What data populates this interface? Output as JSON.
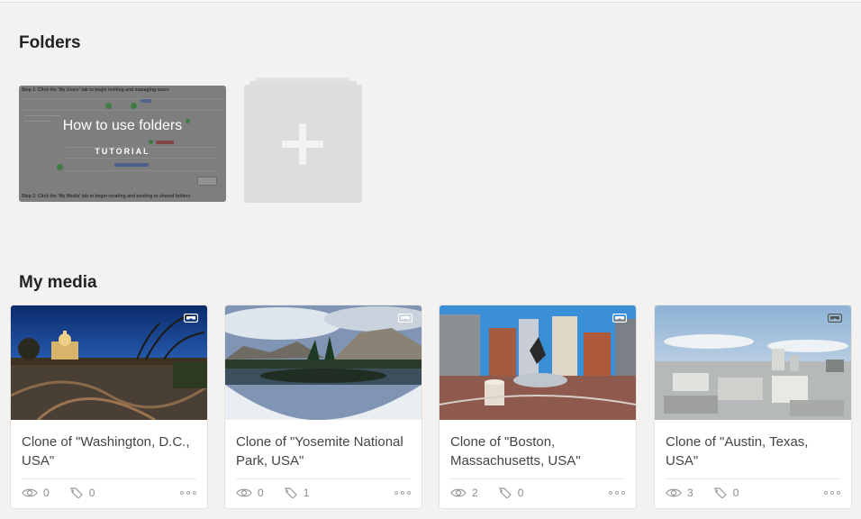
{
  "folders_section": {
    "title": "Folders",
    "tutorial_card": {
      "title": "How to use folders",
      "subtitle": "TUTORIAL",
      "step1": "Step 1: Click the 'My Users' tab to begin inviting and managing users",
      "step2": "Step 2: Click the 'My Media' tab to begin creating and posting to shared folders"
    },
    "add_folder_icon": "plus-icon"
  },
  "media_section": {
    "title": "My media",
    "items": [
      {
        "title": "Clone of \"Washington, D.C., USA\"",
        "views": "0",
        "tags": "0"
      },
      {
        "title": "Clone of \"Yosemite National Park, USA\"",
        "views": "0",
        "tags": "1"
      },
      {
        "title": "Clone of \"Boston, Massachusetts, USA\"",
        "views": "2",
        "tags": "0"
      },
      {
        "title": "Clone of \"Austin, Texas, USA\"",
        "views": "3",
        "tags": "0"
      }
    ],
    "icons": {
      "vr": "vr-headset-icon",
      "views": "eye-icon",
      "tags": "tag-icon",
      "more": "more-dots-icon"
    }
  }
}
